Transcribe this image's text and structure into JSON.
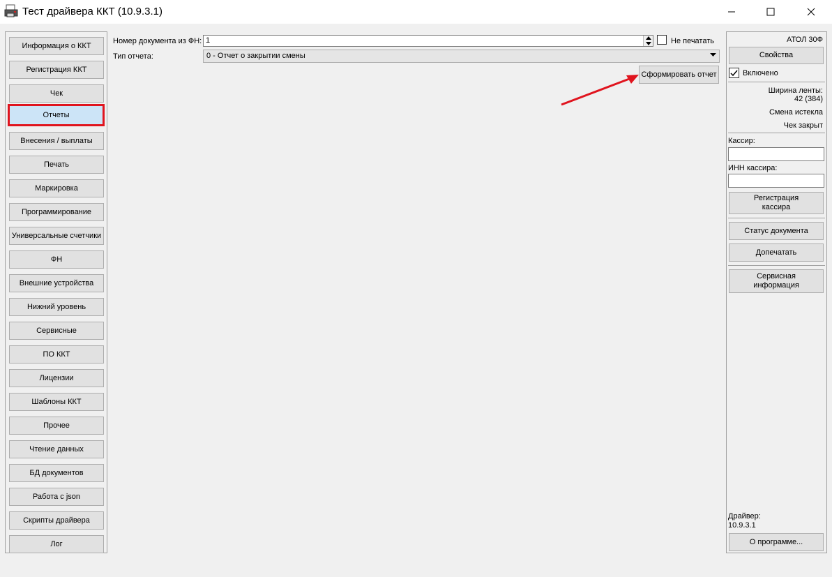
{
  "window": {
    "title": "Тест драйвера ККТ (10.9.3.1)"
  },
  "nav": {
    "items": [
      {
        "label": "Информация о ККТ"
      },
      {
        "label": "Регистрация ККТ"
      },
      {
        "label": "Чек"
      },
      {
        "label": "Отчеты",
        "active": true
      },
      {
        "label": "Внесения / выплаты"
      },
      {
        "label": "Печать"
      },
      {
        "label": "Маркировка"
      },
      {
        "label": "Программирование"
      },
      {
        "label": "Универсальные счетчики"
      },
      {
        "label": "ФН"
      },
      {
        "label": "Внешние устройства"
      },
      {
        "label": "Нижний уровень"
      },
      {
        "label": "Сервисные"
      },
      {
        "label": "ПО ККТ"
      },
      {
        "label": "Лицензии"
      },
      {
        "label": "Шаблоны ККТ"
      },
      {
        "label": "Прочее"
      },
      {
        "label": "Чтение данных"
      },
      {
        "label": "БД документов"
      },
      {
        "label": "Работа с json"
      },
      {
        "label": "Скрипты драйвера"
      },
      {
        "label": "Лог"
      }
    ]
  },
  "main": {
    "doc_number_label": "Номер документа из ФН:",
    "doc_number_value": "1",
    "no_print_label": "Не печатать",
    "no_print_checked": false,
    "report_type_label": "Тип отчета:",
    "report_type_value": "0 - Отчет о закрытии смены",
    "generate_button": "Сформировать отчет"
  },
  "right": {
    "device_name": "АТОЛ 30Ф",
    "properties_button": "Свойства",
    "enabled_label": "Включено",
    "enabled_checked": true,
    "tape_width_label": "Ширина ленты:",
    "tape_width_value": "42 (384)",
    "shift_status": "Смена истекла",
    "receipt_status": "Чек закрыт",
    "cashier_label": "Кассир:",
    "cashier_inn_label": "ИНН кассира:",
    "register_cashier_line1": "Регистрация",
    "register_cashier_line2": "кассира",
    "doc_status_button": "Статус документа",
    "reprint_button": "Допечатать",
    "service_info_line1": "Сервисная",
    "service_info_line2": "информация",
    "driver_label": "Драйвер:",
    "driver_version": "10.9.3.1",
    "about_button": "О программе..."
  },
  "colors": {
    "active_tab_bg": "#cce4f7",
    "highlight_red": "#e0141e"
  }
}
